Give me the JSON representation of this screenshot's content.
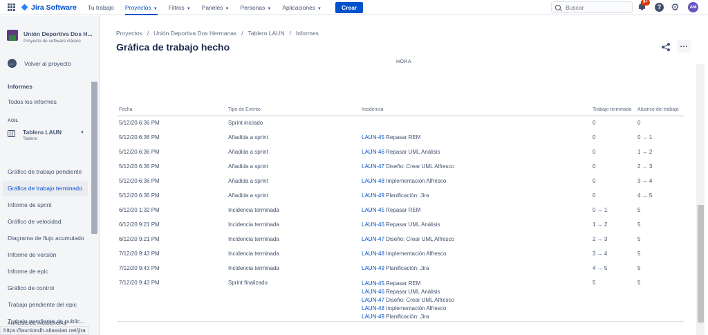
{
  "topnav": {
    "logo": "Jira Software",
    "items": [
      {
        "label": "Tu trabajo",
        "dropdown": false,
        "active": false
      },
      {
        "label": "Proyectos",
        "dropdown": true,
        "active": true
      },
      {
        "label": "Filtros",
        "dropdown": true,
        "active": false
      },
      {
        "label": "Paneles",
        "dropdown": true,
        "active": false
      },
      {
        "label": "Personas",
        "dropdown": true,
        "active": false
      },
      {
        "label": "Aplicaciones",
        "dropdown": true,
        "active": false
      }
    ],
    "create_label": "Crear",
    "search_placeholder": "Buscar",
    "notifications_count": "9+",
    "help_icon": "?",
    "avatar_initials": "AM"
  },
  "sidebar": {
    "project_name": "Unión Deportiva Dos H...",
    "project_type": "Proyecto de software clásico",
    "back_label": "Volver al proyecto",
    "reports_heading": "Informes",
    "all_reports": "Todos los informes",
    "agile_group": "ÁGIL",
    "board_name": "Tablero LAUN",
    "board_sub": "Tablero",
    "items": [
      {
        "label": "Gráfico de trabajo pendiente",
        "active": false
      },
      {
        "label": "Gráfica de trabajo terminado",
        "active": true
      },
      {
        "label": "Informe de sprint",
        "active": false
      },
      {
        "label": "Gráfico de velocidad",
        "active": false
      },
      {
        "label": "Diagrama de flujo acumulado",
        "active": false
      },
      {
        "label": "Informe de versión",
        "active": false
      },
      {
        "label": "Informe de epic",
        "active": false
      },
      {
        "label": "Gráfico de control",
        "active": false
      },
      {
        "label": "Trabajo pendiente del epic",
        "active": false
      },
      {
        "label": "Trabajo pendiente de public...",
        "active": false
      }
    ],
    "issue_analysis_group": "ANÁLISIS DE INCIDENCIAS",
    "status_url": "https://launiondh.atlassian.net/jira"
  },
  "main": {
    "breadcrumbs": [
      "Proyectos",
      "Unión Deportiva Dos Hermanas",
      "Tablero LAUN",
      "Informes"
    ],
    "title": "Gráfica de trabajo hecho",
    "chart_axis_label": "HORA",
    "table": {
      "columns": [
        "Fecha",
        "Tipo de Evento",
        "Incidencia",
        "Trabajo terminado",
        "Alcance del trabajo"
      ],
      "rows": [
        {
          "date": "5/12/20 6:36 PM",
          "event": "Sprint iniciado",
          "issues": [],
          "done": "0",
          "scope": "0"
        },
        {
          "date": "5/12/20 6:36 PM",
          "event": "Añadida a sprint",
          "issues": [
            {
              "key": "LAUN-45",
              "summary": "Repasar REM"
            }
          ],
          "done": "0",
          "scope": "0 → 1"
        },
        {
          "date": "5/12/20 6:36 PM",
          "event": "Añadida a sprint",
          "issues": [
            {
              "key": "LAUN-46",
              "summary": "Repasar UML Análisis"
            }
          ],
          "done": "0",
          "scope": "1 → 2"
        },
        {
          "date": "5/12/20 6:36 PM",
          "event": "Añadida a sprint",
          "issues": [
            {
              "key": "LAUN-47",
              "summary": "Diseño: Crear UML Alfresco"
            }
          ],
          "done": "0",
          "scope": "2 → 3"
        },
        {
          "date": "5/12/20 6:36 PM",
          "event": "Añadida a sprint",
          "issues": [
            {
              "key": "LAUN-48",
              "summary": "Implementación Alfresco"
            }
          ],
          "done": "0",
          "scope": "3 → 4"
        },
        {
          "date": "5/12/20 6:36 PM",
          "event": "Añadida a sprint",
          "issues": [
            {
              "key": "LAUN-49",
              "summary": "Planificación: Jira"
            }
          ],
          "done": "0",
          "scope": "4 → 5"
        },
        {
          "date": "6/12/20 1:32 PM",
          "event": "Incidencia terminada",
          "issues": [
            {
              "key": "LAUN-45",
              "summary": "Repasar REM"
            }
          ],
          "done": "0 → 1",
          "scope": "5"
        },
        {
          "date": "6/12/20 9:21 PM",
          "event": "Incidencia terminada",
          "issues": [
            {
              "key": "LAUN-46",
              "summary": "Repasar UML Análisis"
            }
          ],
          "done": "1 → 2",
          "scope": "5"
        },
        {
          "date": "6/12/20 9:21 PM",
          "event": "Incidencia terminada",
          "issues": [
            {
              "key": "LAUN-47",
              "summary": "Diseño: Crear UML Alfresco"
            }
          ],
          "done": "2 → 3",
          "scope": "5"
        },
        {
          "date": "7/12/20 9:43 PM",
          "event": "Incidencia terminada",
          "issues": [
            {
              "key": "LAUN-48",
              "summary": "Implementación Alfresco"
            }
          ],
          "done": "3 → 4",
          "scope": "5"
        },
        {
          "date": "7/12/20 9:43 PM",
          "event": "Incidencia terminada",
          "issues": [
            {
              "key": "LAUN-49",
              "summary": "Planificación: Jira"
            }
          ],
          "done": "4 → 5",
          "scope": "5"
        },
        {
          "date": "7/12/20 9:43 PM",
          "event": "Sprint finalizado",
          "issues": [
            {
              "key": "LAUN-45",
              "summary": "Repasar REM"
            },
            {
              "key": "LAUN-46",
              "summary": "Repasar UML Análisis"
            },
            {
              "key": "LAUN-47",
              "summary": "Diseño: Crear UML Alfresco"
            },
            {
              "key": "LAUN-48",
              "summary": "Implementación Alfresco"
            },
            {
              "key": "LAUN-49",
              "summary": "Planificación: Jira"
            }
          ],
          "done": "5",
          "scope": "5"
        }
      ]
    }
  },
  "colors": {
    "brand": "#0052cc",
    "text": "#172b4d",
    "muted": "#42526e",
    "sidebar_bg": "#f4f5f7",
    "notification": "#de350b"
  }
}
